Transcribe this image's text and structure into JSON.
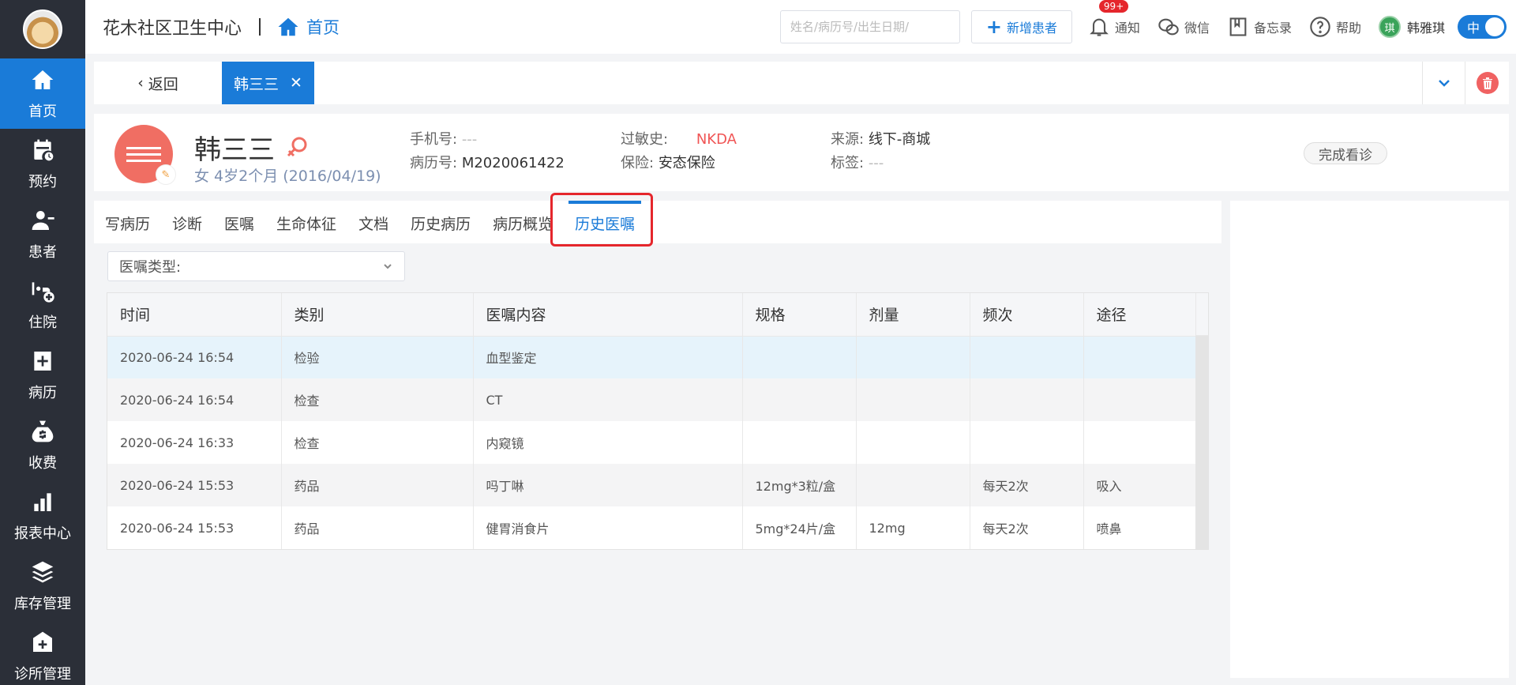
{
  "sidebar": {
    "items": [
      {
        "label": "首页",
        "icon": "home-icon"
      },
      {
        "label": "预约",
        "icon": "calendar-icon"
      },
      {
        "label": "患者",
        "icon": "patient-icon"
      },
      {
        "label": "住院",
        "icon": "hospital-bed-icon"
      },
      {
        "label": "病历",
        "icon": "medical-record-icon"
      },
      {
        "label": "收费",
        "icon": "money-bag-icon"
      },
      {
        "label": "报表中心",
        "icon": "bar-chart-icon"
      },
      {
        "label": "库存管理",
        "icon": "layers-icon"
      },
      {
        "label": "诊所管理",
        "icon": "clinic-icon"
      }
    ]
  },
  "header": {
    "clinic_name": "花木社区卫生中心",
    "home_label": "首页",
    "search_placeholder": "姓名/病历号/出生日期/",
    "new_patient_label": "新增患者",
    "notice_label": "通知",
    "notice_badge": "99+",
    "wechat_label": "微信",
    "memo_label": "备忘录",
    "help_label": "帮助",
    "user_name": "韩雅琪",
    "user_initial": "琪",
    "lang_label": "中"
  },
  "tabstrip": {
    "back_label": "返回",
    "patient_tab": "韩三三"
  },
  "patient": {
    "name": "韩三三",
    "sub": "女  4岁2个月  (2016/04/19)",
    "phone_label": "手机号:",
    "phone_value": "---",
    "record_label": "病历号:",
    "record_value": "M2020061422",
    "allergy_label": "过敏史:",
    "allergy_value": "NKDA",
    "insurance_label": "保险:",
    "insurance_value": "安态保险",
    "source_label": "来源:",
    "source_value": "线下-商城",
    "tag_label": "标签:",
    "tag_value": "---",
    "finish_label": "完成看诊"
  },
  "tabs": [
    "写病历",
    "诊断",
    "医嘱",
    "生命体征",
    "文档",
    "历史病历",
    "病历概览",
    "历史医嘱"
  ],
  "filter": {
    "label": "医嘱类型:"
  },
  "table": {
    "headers": [
      "时间",
      "类别",
      "医嘱内容",
      "规格",
      "剂量",
      "频次",
      "途径"
    ],
    "rows": [
      [
        "2020-06-24 16:54",
        "检验",
        "血型鉴定",
        "",
        "",
        "",
        ""
      ],
      [
        "2020-06-24 16:54",
        "检查",
        "CT",
        "",
        "",
        "",
        ""
      ],
      [
        "2020-06-24 16:33",
        "检查",
        "内窥镜",
        "",
        "",
        "",
        ""
      ],
      [
        "2020-06-24 15:53",
        "药品",
        "吗丁啉",
        "12mg*3粒/盒",
        "",
        "每天2次",
        "吸入"
      ],
      [
        "2020-06-24 15:53",
        "药品",
        "健胃消食片",
        "5mg*24片/盒",
        "12mg",
        "每天2次",
        "喷鼻"
      ]
    ]
  },
  "colors": {
    "accent": "#1a7bd8",
    "sidebar": "#2b2f38",
    "allergy": "#f05555",
    "highlight": "#e5262c"
  }
}
